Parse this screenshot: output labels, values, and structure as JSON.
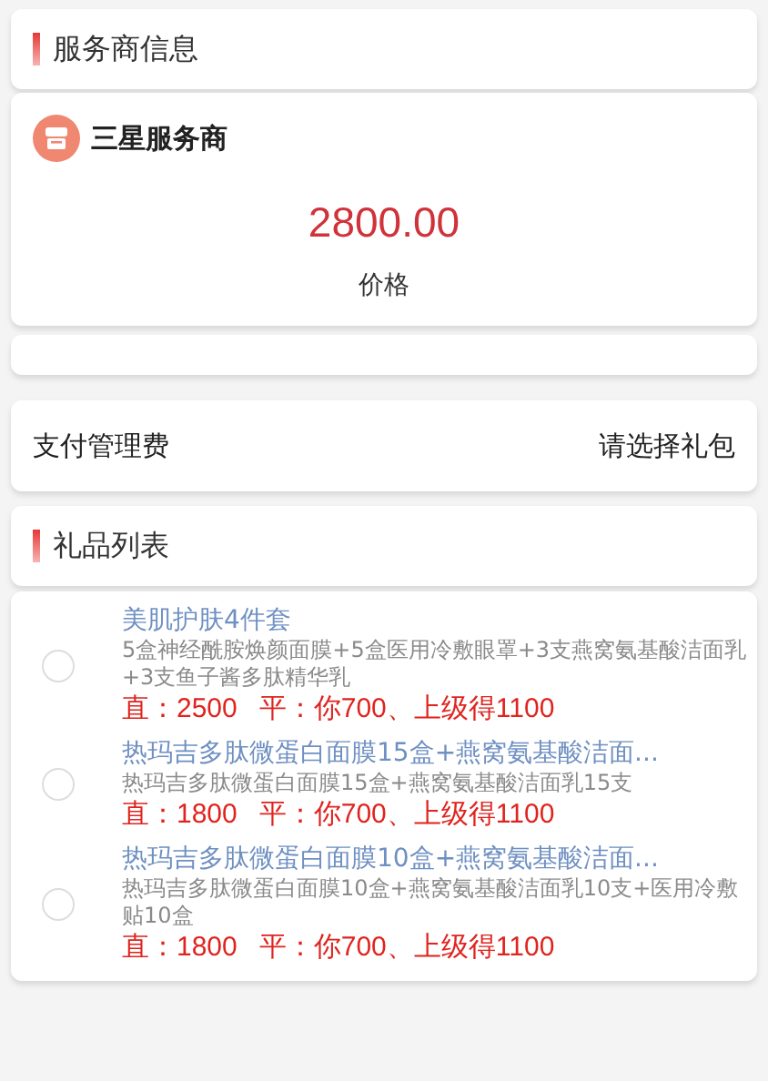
{
  "provider_section": {
    "title": "服务商信息"
  },
  "provider": {
    "name": "三星服务商",
    "price": "2800.00",
    "price_label": "价格"
  },
  "fee_row": {
    "label": "支付管理费",
    "value": "请选择礼包"
  },
  "gift_section": {
    "title": "礼品列表"
  },
  "gifts": [
    {
      "title": "美肌护肤4件套",
      "description": "5盒神经酰胺焕颜面膜+5盒医用冷敷眼罩+3支燕窝氨基酸洁面乳+3支鱼子酱多肽精华乳",
      "selected": false,
      "notes": [
        "直：2500",
        "平：你700、上级得1100"
      ]
    },
    {
      "title": "热玛吉多肽微蛋白面膜15盒+燕窝氨基酸洁面...",
      "description": "热玛吉多肽微蛋白面膜15盒+燕窝氨基酸洁面乳15支",
      "selected": false,
      "notes": [
        "直：1800",
        "平：你700、上级得1100"
      ]
    },
    {
      "title": "热玛吉多肽微蛋白面膜10盒+燕窝氨基酸洁面...",
      "description": "热玛吉多肽微蛋白面膜10盒+燕窝氨基酸洁面乳10支+医用冷敷贴10盒",
      "selected": false,
      "notes": [
        "直：1800",
        "平：你700、上级得1100"
      ]
    }
  ]
}
